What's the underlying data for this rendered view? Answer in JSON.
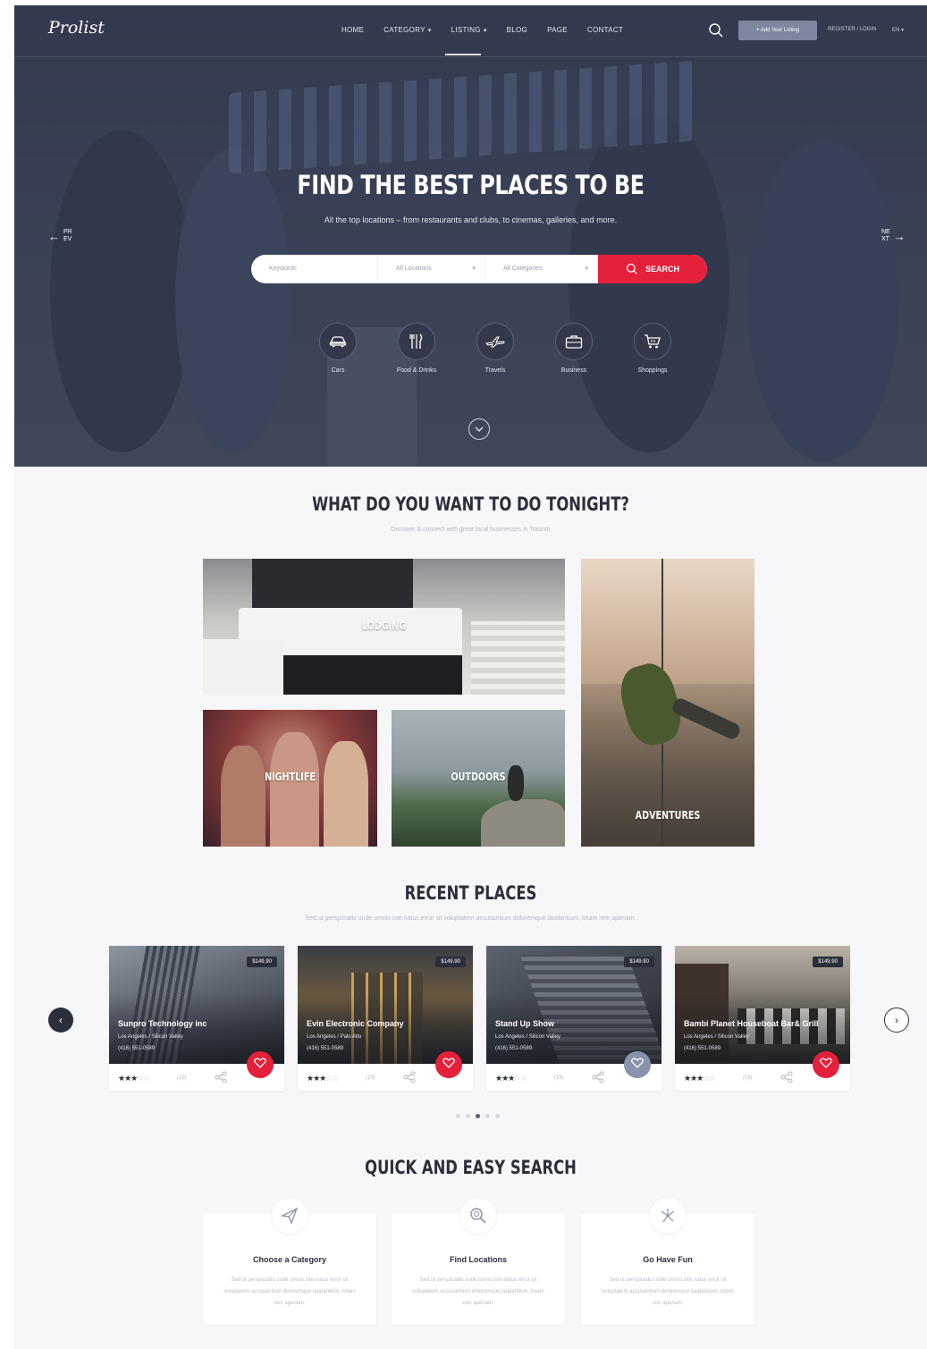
{
  "header": {
    "logo": "Prolist",
    "nav": [
      {
        "label": "HOME",
        "dropdown": false
      },
      {
        "label": "CATEGORY",
        "dropdown": true
      },
      {
        "label": "LISTING",
        "dropdown": true
      },
      {
        "label": "BLOG",
        "dropdown": false
      },
      {
        "label": "PAGE",
        "dropdown": false
      },
      {
        "label": "CONTACT",
        "dropdown": false
      }
    ],
    "add_listing": "+ Add Your Listing",
    "register_login": "REGISTER / LOGIN",
    "language": "EN"
  },
  "hero": {
    "title": "FIND THE BEST PLACES TO BE",
    "subtitle": "All the top locations – from restaurants and clubs, to cinemas, galleries, and more.",
    "prev_label": [
      "PR",
      "EV"
    ],
    "next_label": [
      "NE",
      "XT"
    ],
    "search": {
      "keywords_placeholder": "Keywords",
      "locations_placeholder": "All Locations",
      "categories_placeholder": "All Categories",
      "button": "SEARCH"
    },
    "categories": [
      {
        "label": "Cars",
        "icon": "car-icon"
      },
      {
        "label": "Food & Drinks",
        "icon": "utensils-icon"
      },
      {
        "label": "Travels",
        "icon": "plane-icon"
      },
      {
        "label": "Business",
        "icon": "briefcase-icon"
      },
      {
        "label": "Shoppings",
        "icon": "cart-icon"
      }
    ]
  },
  "tonight": {
    "title": "WHAT DO YOU WANT TO DO TONIGHT?",
    "subtitle": "Discover & connect with great local businesses in Toronto",
    "tiles": [
      "LODGING",
      "NIGHTLIFE",
      "OUTDOORS",
      "ADVENTURES"
    ]
  },
  "recent": {
    "title": "RECENT PLACES",
    "subtitle": "Sed ut perspiciatis unde omnis iste natus error sit voluptatem accusantium doloremque laudantium, totam rem aperiam.",
    "cards": [
      {
        "price": "$149.90",
        "name": "Sunpro Technology inc",
        "location": "Los Angeles / Silicon Valley",
        "phone": "(416) 551-0589",
        "rating": 3,
        "reviews": "(19)",
        "favorited": true
      },
      {
        "price": "$149.90",
        "name": "Evin Electronic Company",
        "location": "Los Angeles / Palo Alto",
        "phone": "(416) 551-0589",
        "rating": 3,
        "reviews": "(19)",
        "favorited": true
      },
      {
        "price": "$149.90",
        "name": "Stand Up Show",
        "location": "Los Angeles / Silicon Valley",
        "phone": "(416) 551-0589",
        "rating": 3,
        "reviews": "(19)",
        "favorited": false
      },
      {
        "price": "$149.90",
        "name": "Bambi Planet Houseboat Bar& Grill",
        "location": "Los Angeles / Silicon Valley",
        "phone": "(416) 551-0589",
        "rating": 3,
        "reviews": "(19)",
        "favorited": true
      }
    ],
    "pagination_dots": 5,
    "active_dot": 2
  },
  "quick": {
    "title": "QUICK AND EASY SEARCH",
    "steps": [
      {
        "title": "Choose a Category",
        "icon": "paper-plane-icon",
        "text": "Sed ut perspiciatis unde omnis iste natus error sit voluptatem accusantium doloremque laudantium, totam rem aperiam."
      },
      {
        "title": "Find Locations",
        "icon": "magnifier-icon",
        "text": "Sed ut perspiciatis unde omnis iste natus error sit voluptatem accusantium doloremque laudantium, totam rem aperiam."
      },
      {
        "title": "Go Have Fun",
        "icon": "fireworks-icon",
        "text": "Sed ut perspiciatis unde omnis iste natus error sit voluptatem accusantium doloremque laudantium, totam rem aperiam."
      }
    ]
  },
  "colors": {
    "accent": "#e5203a",
    "dark": "#2b2f3b",
    "muted_heart": "#8a93ab"
  }
}
